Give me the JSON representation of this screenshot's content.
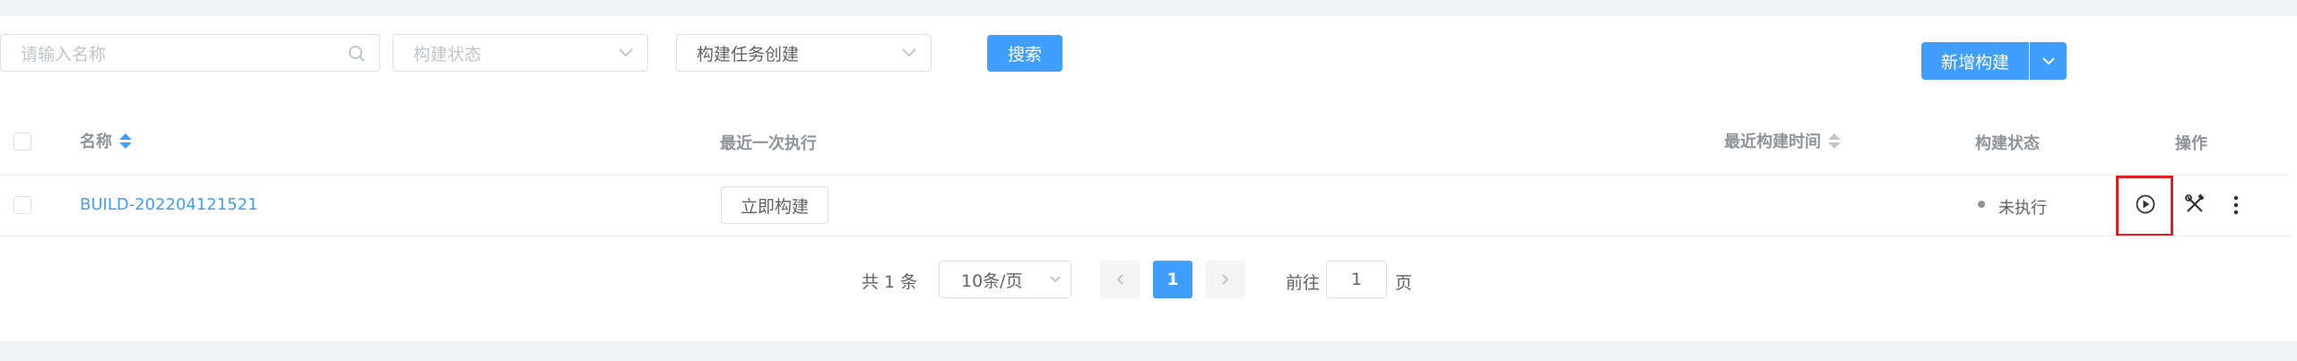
{
  "filters": {
    "name_placeholder": "请输入名称",
    "status_placeholder": "构建状态",
    "trigger_value": "构建任务创建",
    "search_label": "搜索",
    "new_build_label": "新增构建"
  },
  "table": {
    "columns": {
      "name": "名称",
      "last_exec": "最近一次执行",
      "last_build_time": "最近构建时间",
      "status": "构建状态",
      "actions": "操作"
    },
    "rows": [
      {
        "name": "BUILD-202204121521",
        "exec_button": "立即构建",
        "status": "未执行"
      }
    ]
  },
  "pagination": {
    "total": "共 1 条",
    "page_size": "10条/页",
    "current_page": "1",
    "goto_prefix": "前往",
    "goto_value": "1",
    "goto_suffix": "页"
  },
  "colors": {
    "primary": "#409eff",
    "highlight_box": "#e02020"
  },
  "icons": [
    "search-icon",
    "chevron-down-icon",
    "sort-icon",
    "play-icon",
    "tools-icon",
    "more-icon",
    "chevron-left-icon",
    "chevron-right-icon"
  ]
}
